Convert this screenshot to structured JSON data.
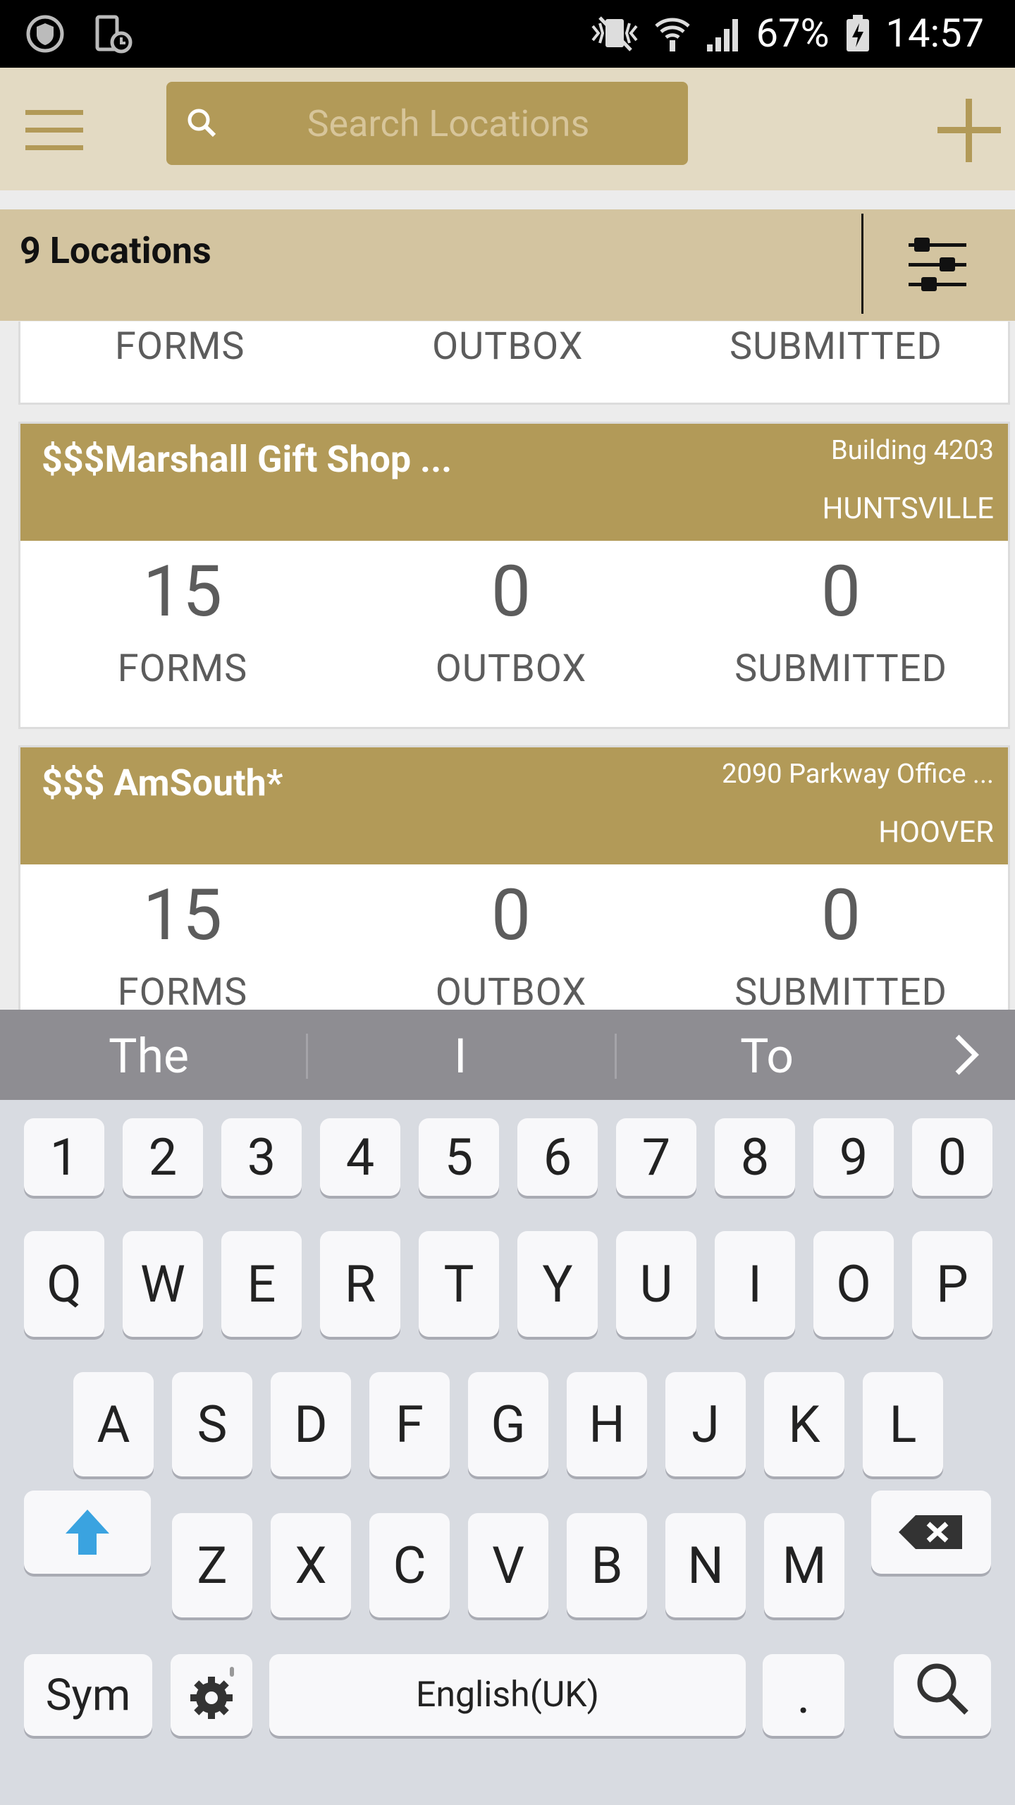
{
  "status_bar": {
    "battery": "67%",
    "time": "14:57"
  },
  "app_bar": {
    "search_placeholder": "Search Locations"
  },
  "location_count": "9 Locations",
  "partial_card": {
    "forms_label": "FORMS",
    "outbox_label": "OUTBOX",
    "submitted_label": "SUBMITTED"
  },
  "cards": [
    {
      "title": "$$$Marshall Gift Shop ...",
      "address": "Building 4203",
      "city": "HUNTSVILLE",
      "forms": "15",
      "outbox": "0",
      "submitted": "0",
      "forms_label": "FORMS",
      "outbox_label": "OUTBOX",
      "submitted_label": "SUBMITTED"
    },
    {
      "title": "$$$ AmSouth*",
      "address": "2090 Parkway Office ...",
      "city": "HOOVER",
      "forms": "15",
      "outbox": "0",
      "submitted": "0",
      "forms_label": "FORMS",
      "outbox_label": "OUTBOX",
      "submitted_label": "SUBMITTED"
    }
  ],
  "keyboard": {
    "suggestions": [
      "The",
      "I",
      "To"
    ],
    "row_numbers": [
      "1",
      "2",
      "3",
      "4",
      "5",
      "6",
      "7",
      "8",
      "9",
      "0"
    ],
    "row1": [
      "Q",
      "W",
      "E",
      "R",
      "T",
      "Y",
      "U",
      "I",
      "O",
      "P"
    ],
    "row2": [
      "A",
      "S",
      "D",
      "F",
      "G",
      "H",
      "J",
      "K",
      "L"
    ],
    "row3": [
      "Z",
      "X",
      "C",
      "V",
      "B",
      "N",
      "M"
    ],
    "sym_label": "Sym",
    "space_label": "English(UK)",
    "period_label": "."
  }
}
